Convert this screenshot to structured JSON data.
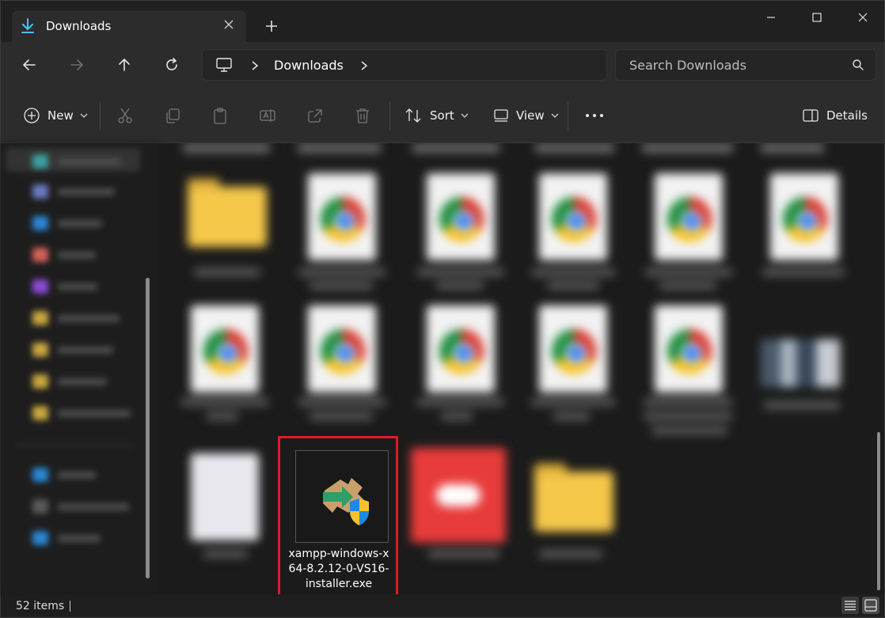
{
  "window": {
    "tab_title": "Downloads",
    "colors": {
      "accent": "#4cc2ff",
      "highlight": "#e01b24",
      "folder": "#f5c84a"
    }
  },
  "address": {
    "crumb": "Downloads",
    "search_placeholder": "Search Downloads"
  },
  "toolbar": {
    "new_label": "New",
    "sort_label": "Sort",
    "view_label": "View",
    "details_label": "Details"
  },
  "files": {
    "selected_name": "xampp-windows-x64-8.2.12-0-VS16-installer.exe"
  },
  "status": {
    "count": "52 items"
  }
}
